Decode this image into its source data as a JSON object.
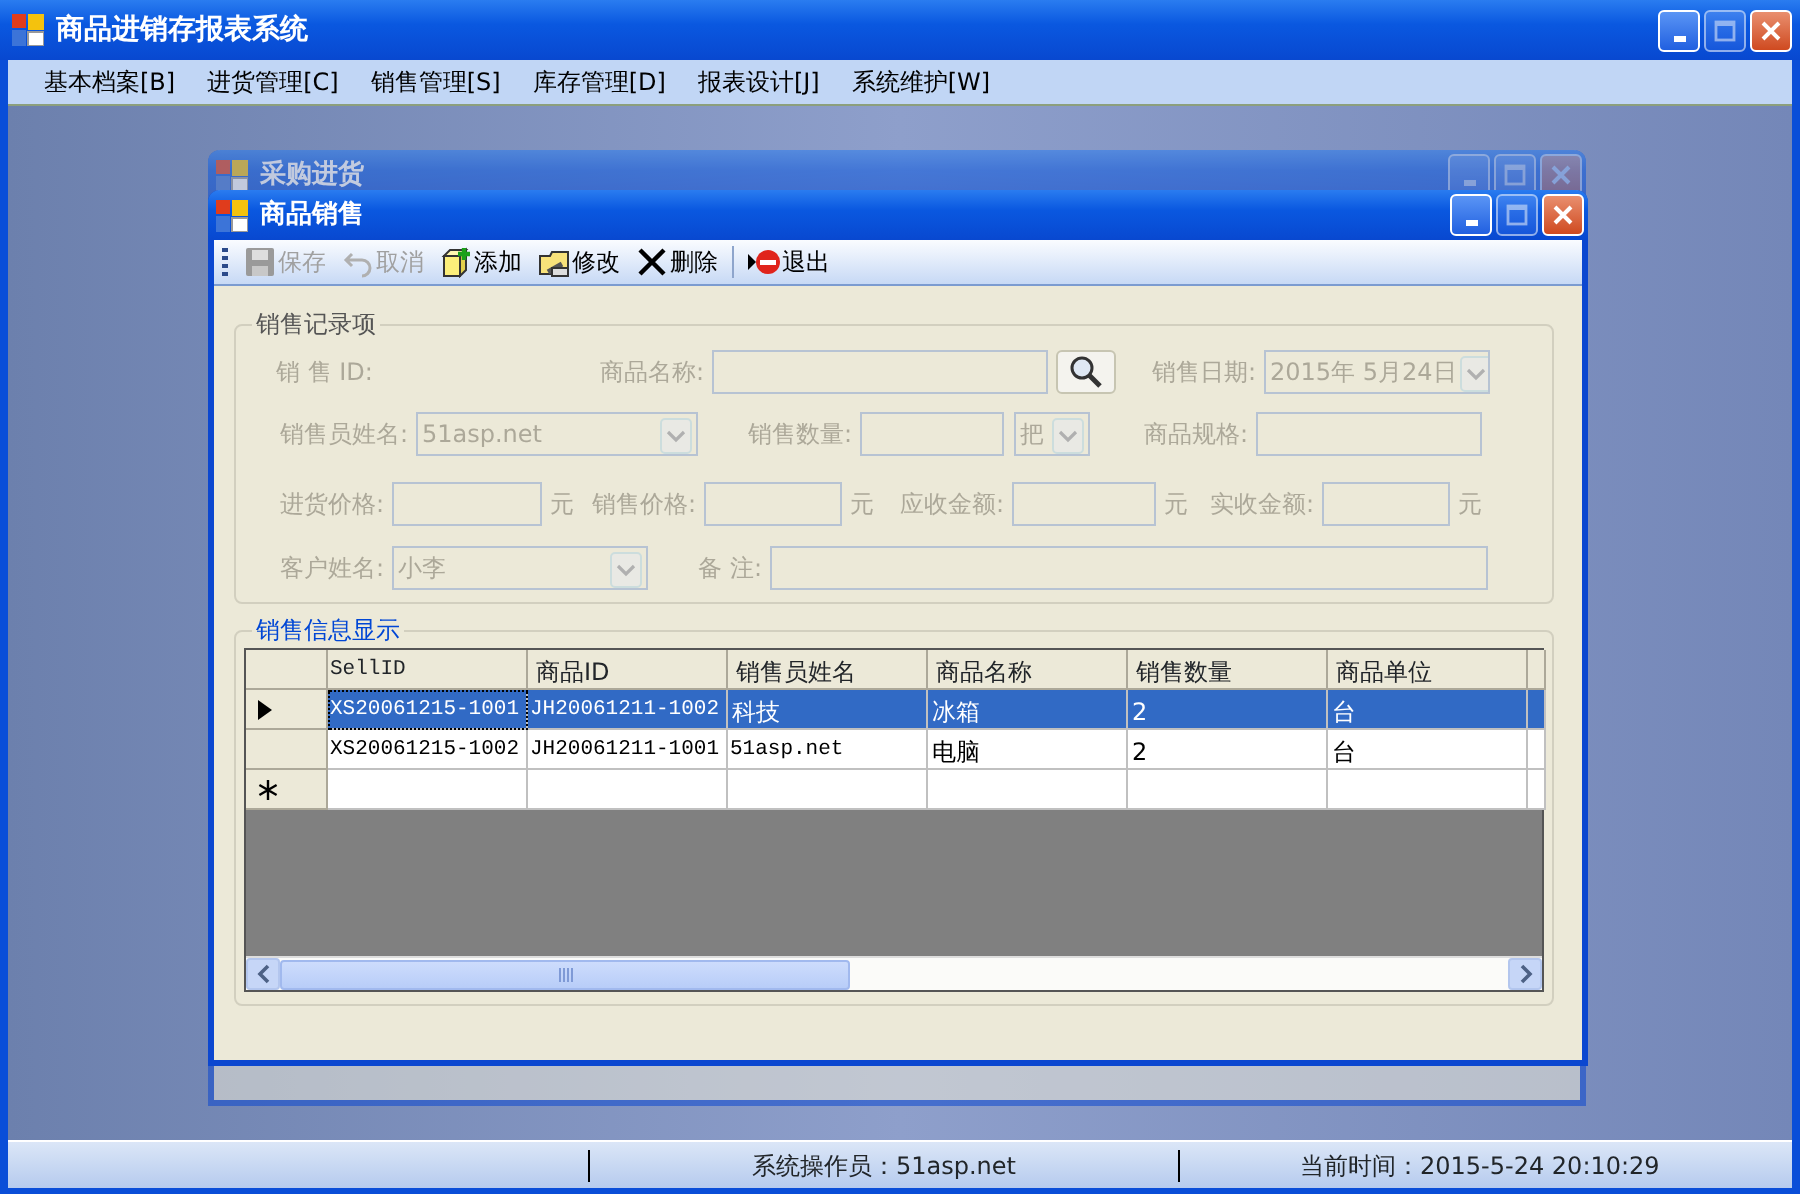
{
  "app": {
    "title": "商品进销存报表系统"
  },
  "menu": [
    {
      "label": "基本档案[B]"
    },
    {
      "label": "进货管理[C]"
    },
    {
      "label": "销售管理[S]"
    },
    {
      "label": "库存管理[D]"
    },
    {
      "label": "报表设计[J]"
    },
    {
      "label": "系统维护[W]"
    }
  ],
  "back_window": {
    "title": "采购进货"
  },
  "window": {
    "title": "商品销售"
  },
  "toolbar": [
    {
      "kind": "button",
      "label": "保存",
      "disabled": true
    },
    {
      "kind": "button",
      "label": "取消",
      "disabled": true
    },
    {
      "kind": "button",
      "label": "添加",
      "disabled": false
    },
    {
      "kind": "button",
      "label": "修改",
      "disabled": false
    },
    {
      "kind": "button",
      "label": "删除",
      "disabled": false
    },
    {
      "kind": "separator"
    },
    {
      "kind": "button",
      "label": "退出",
      "disabled": false
    }
  ],
  "record_group": {
    "title": "销售记录项",
    "disabled": true,
    "rows": [
      [
        {
          "label": "销 售 ID:",
          "kind": "none"
        },
        {
          "label": "商品名称:",
          "kind": "search"
        },
        {
          "label": "销售日期:",
          "kind": "combo",
          "value": "2015年 5月24日"
        }
      ],
      [
        {
          "label": "销售员姓名:",
          "kind": "combo",
          "value": "51asp.net"
        },
        {
          "label": "销售数量:",
          "kind": "text"
        },
        {
          "kind": "combo",
          "value": "把"
        },
        {
          "label": "商品规格:",
          "kind": "text"
        }
      ],
      [
        {
          "label": "进货价格:",
          "kind": "text",
          "unit": "元"
        },
        {
          "label": "销售价格:",
          "kind": "text",
          "unit": "元"
        },
        {
          "label": "应收金额:",
          "kind": "text",
          "unit": "元"
        },
        {
          "label": "实收金额:",
          "kind": "text",
          "unit": "元"
        }
      ],
      [
        {
          "label": "客户姓名:",
          "kind": "combo",
          "value": "小李"
        },
        {
          "label": "备  注:",
          "kind": "text"
        }
      ]
    ]
  },
  "grid_group": {
    "title": "销售信息显示",
    "columns": [
      "SellID",
      "商品ID",
      "销售员姓名",
      "商品名称",
      "销售数量",
      "商品单位"
    ],
    "rows": [
      {
        "kind": "data",
        "selected": true,
        "cells": [
          "XS20061215-1001",
          "JH20061211-1002",
          "科技",
          "冰箱",
          "2",
          "台"
        ]
      },
      {
        "kind": "data",
        "selected": false,
        "cells": [
          "XS20061215-1002",
          "JH20061211-1001",
          "51asp.net",
          "电脑",
          "2",
          "台"
        ]
      },
      {
        "kind": "new",
        "selected": false,
        "cells": []
      }
    ]
  },
  "status_bar": [
    {
      "text": "系统操作员：51asp.net"
    },
    {
      "text": "当前时间：2015-5-24 20:10:29"
    }
  ]
}
